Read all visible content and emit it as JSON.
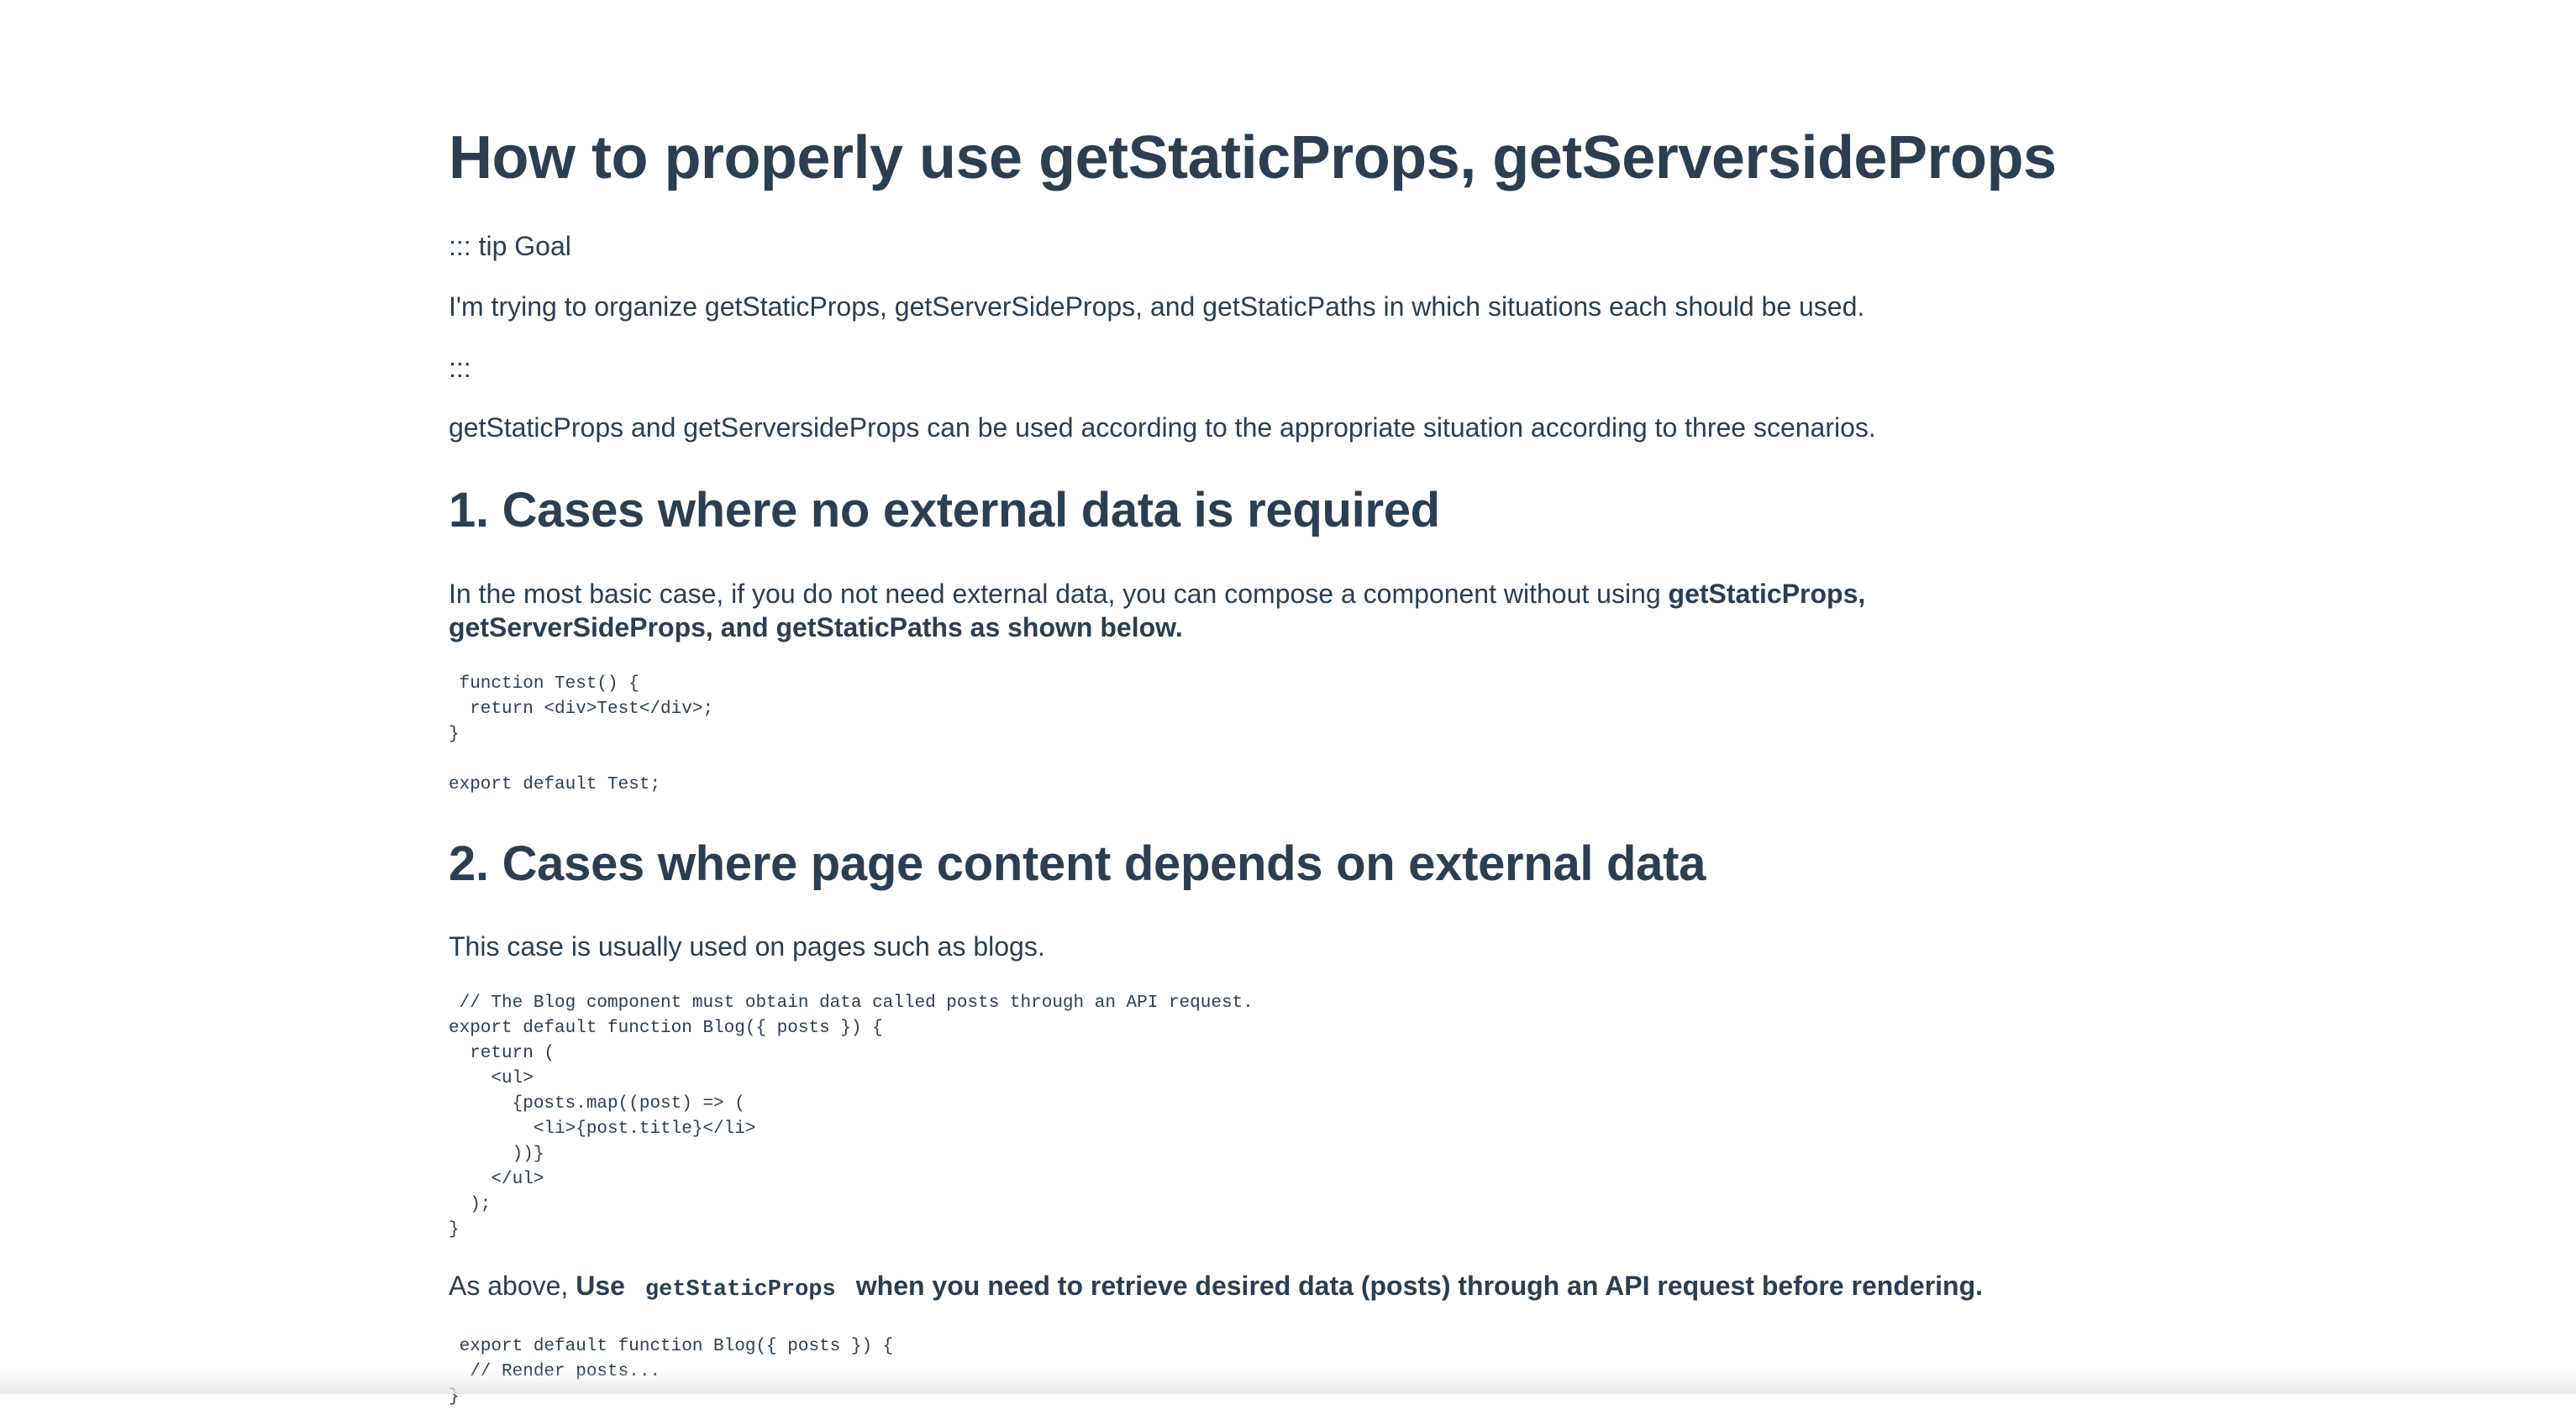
{
  "article": {
    "title": "How to properly use getStaticProps, getServersideProps",
    "tip_open": "::: tip Goal",
    "tip_body": "I'm trying to organize getStaticProps, getServerSideProps, and getStaticPaths in which situations each should be used.",
    "tip_close": ":::",
    "intro": "getStaticProps and getServersideProps can be used according to the appropriate situation according to three scenarios."
  },
  "section1": {
    "heading": "1. Cases where no external data is required",
    "text_plain": "In the most basic case, if you do not need external data, you can compose a component without using ",
    "text_bold_1": "getStaticProps,",
    "text_bold_2": "getServerSideProps, and getStaticPaths as shown below.",
    "code": " function Test() {\n  return <div>Test</div>;\n}\n\nexport default Test;"
  },
  "section2": {
    "heading": "2. Cases where page content depends on external data",
    "text": "This case is usually used on pages such as blogs.",
    "code": " // The Blog component must obtain data called posts through an API request.\nexport default function Blog({ posts }) {\n  return (\n    <ul>\n      {posts.map((post) => (\n        <li>{post.title}</li>\n      ))}\n    </ul>\n  );\n}",
    "after_plain": "As above, ",
    "after_bold_1": "Use",
    "after_inline_code": "getStaticProps",
    "after_bold_2": "when you need to retrieve desired data (posts) through an API request before rendering.",
    "code2": " export default function Blog({ posts }) {\n  // Render posts...\n}"
  }
}
